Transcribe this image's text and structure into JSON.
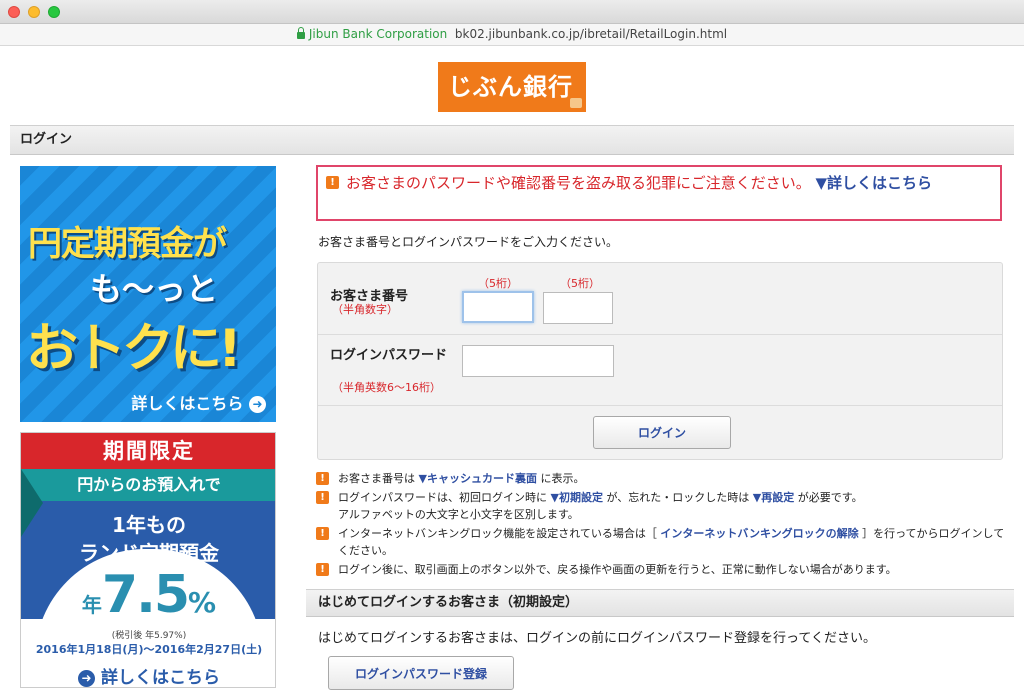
{
  "browser": {
    "org": "Jibun Bank Corporation",
    "url": "bk02.jibunbank.co.jp/ibretail/RetailLogin.html"
  },
  "logo": {
    "text": "じぶん銀行",
    "brand_color": "#f07a1a"
  },
  "section_title": "ログイン",
  "banner1": {
    "line1": "円定期預金が",
    "line2": "も～っと",
    "line3": "おトクに!",
    "more": "詳しくはこちら"
  },
  "banner2": {
    "top": "期間限定",
    "teal": "円からのお預入れで",
    "line1": "1年もの",
    "line2": "ランド定期預金",
    "rate_prefix": "年",
    "rate": "7.5",
    "rate_unit": "%",
    "note": "(税引後 年5.97%)",
    "dates": "2016年1月18日(月)～2016年2月27日(土)",
    "more": "詳しくはこちら"
  },
  "warning": {
    "text": "お客さまのパスワードや確認番号を盗み取る犯罪にご注意ください。",
    "link": "▼詳しくはこちら"
  },
  "instruction": "お客さま番号とログインパスワードをご入力ください。",
  "form": {
    "customer_no_label": "お客さま番号",
    "customer_no_sub": "（半角数字）",
    "digits1": "（5桁）",
    "digits2": "（5桁）",
    "password_label": "ログインパスワード",
    "password_sub": "（半角英数6～16桁）",
    "login_button": "ログイン"
  },
  "notes": [
    {
      "pre": "お客さま番号は ",
      "link1": "▼キャッシュカード裏面",
      "post": " に表示。"
    },
    {
      "pre": "ログインパスワードは、初回ログイン時に ",
      "link1": "▼初期設定",
      "mid": " が、忘れた・ロックした時は ",
      "link2": "▼再設定",
      "post": " が必要です。",
      "line2": "アルファベットの大文字と小文字を区別します。"
    },
    {
      "pre": "インターネットバンキングロック機能を設定されている場合は［ ",
      "link1": "インターネットバンキングロックの解除",
      "post": " ］を行ってからログインしてください。"
    },
    {
      "pre": "ログイン後に、取引画面上のボタン以外で、戻る操作や画面の更新を行うと、正常に動作しない場合があります。"
    }
  ],
  "first_login": {
    "title": "はじめてログインするお客さま（初期設定）",
    "text": "はじめてログインするお客さまは、ログインの前にログインパスワード登録を行ってください。",
    "button": "ログインパスワード登録"
  }
}
